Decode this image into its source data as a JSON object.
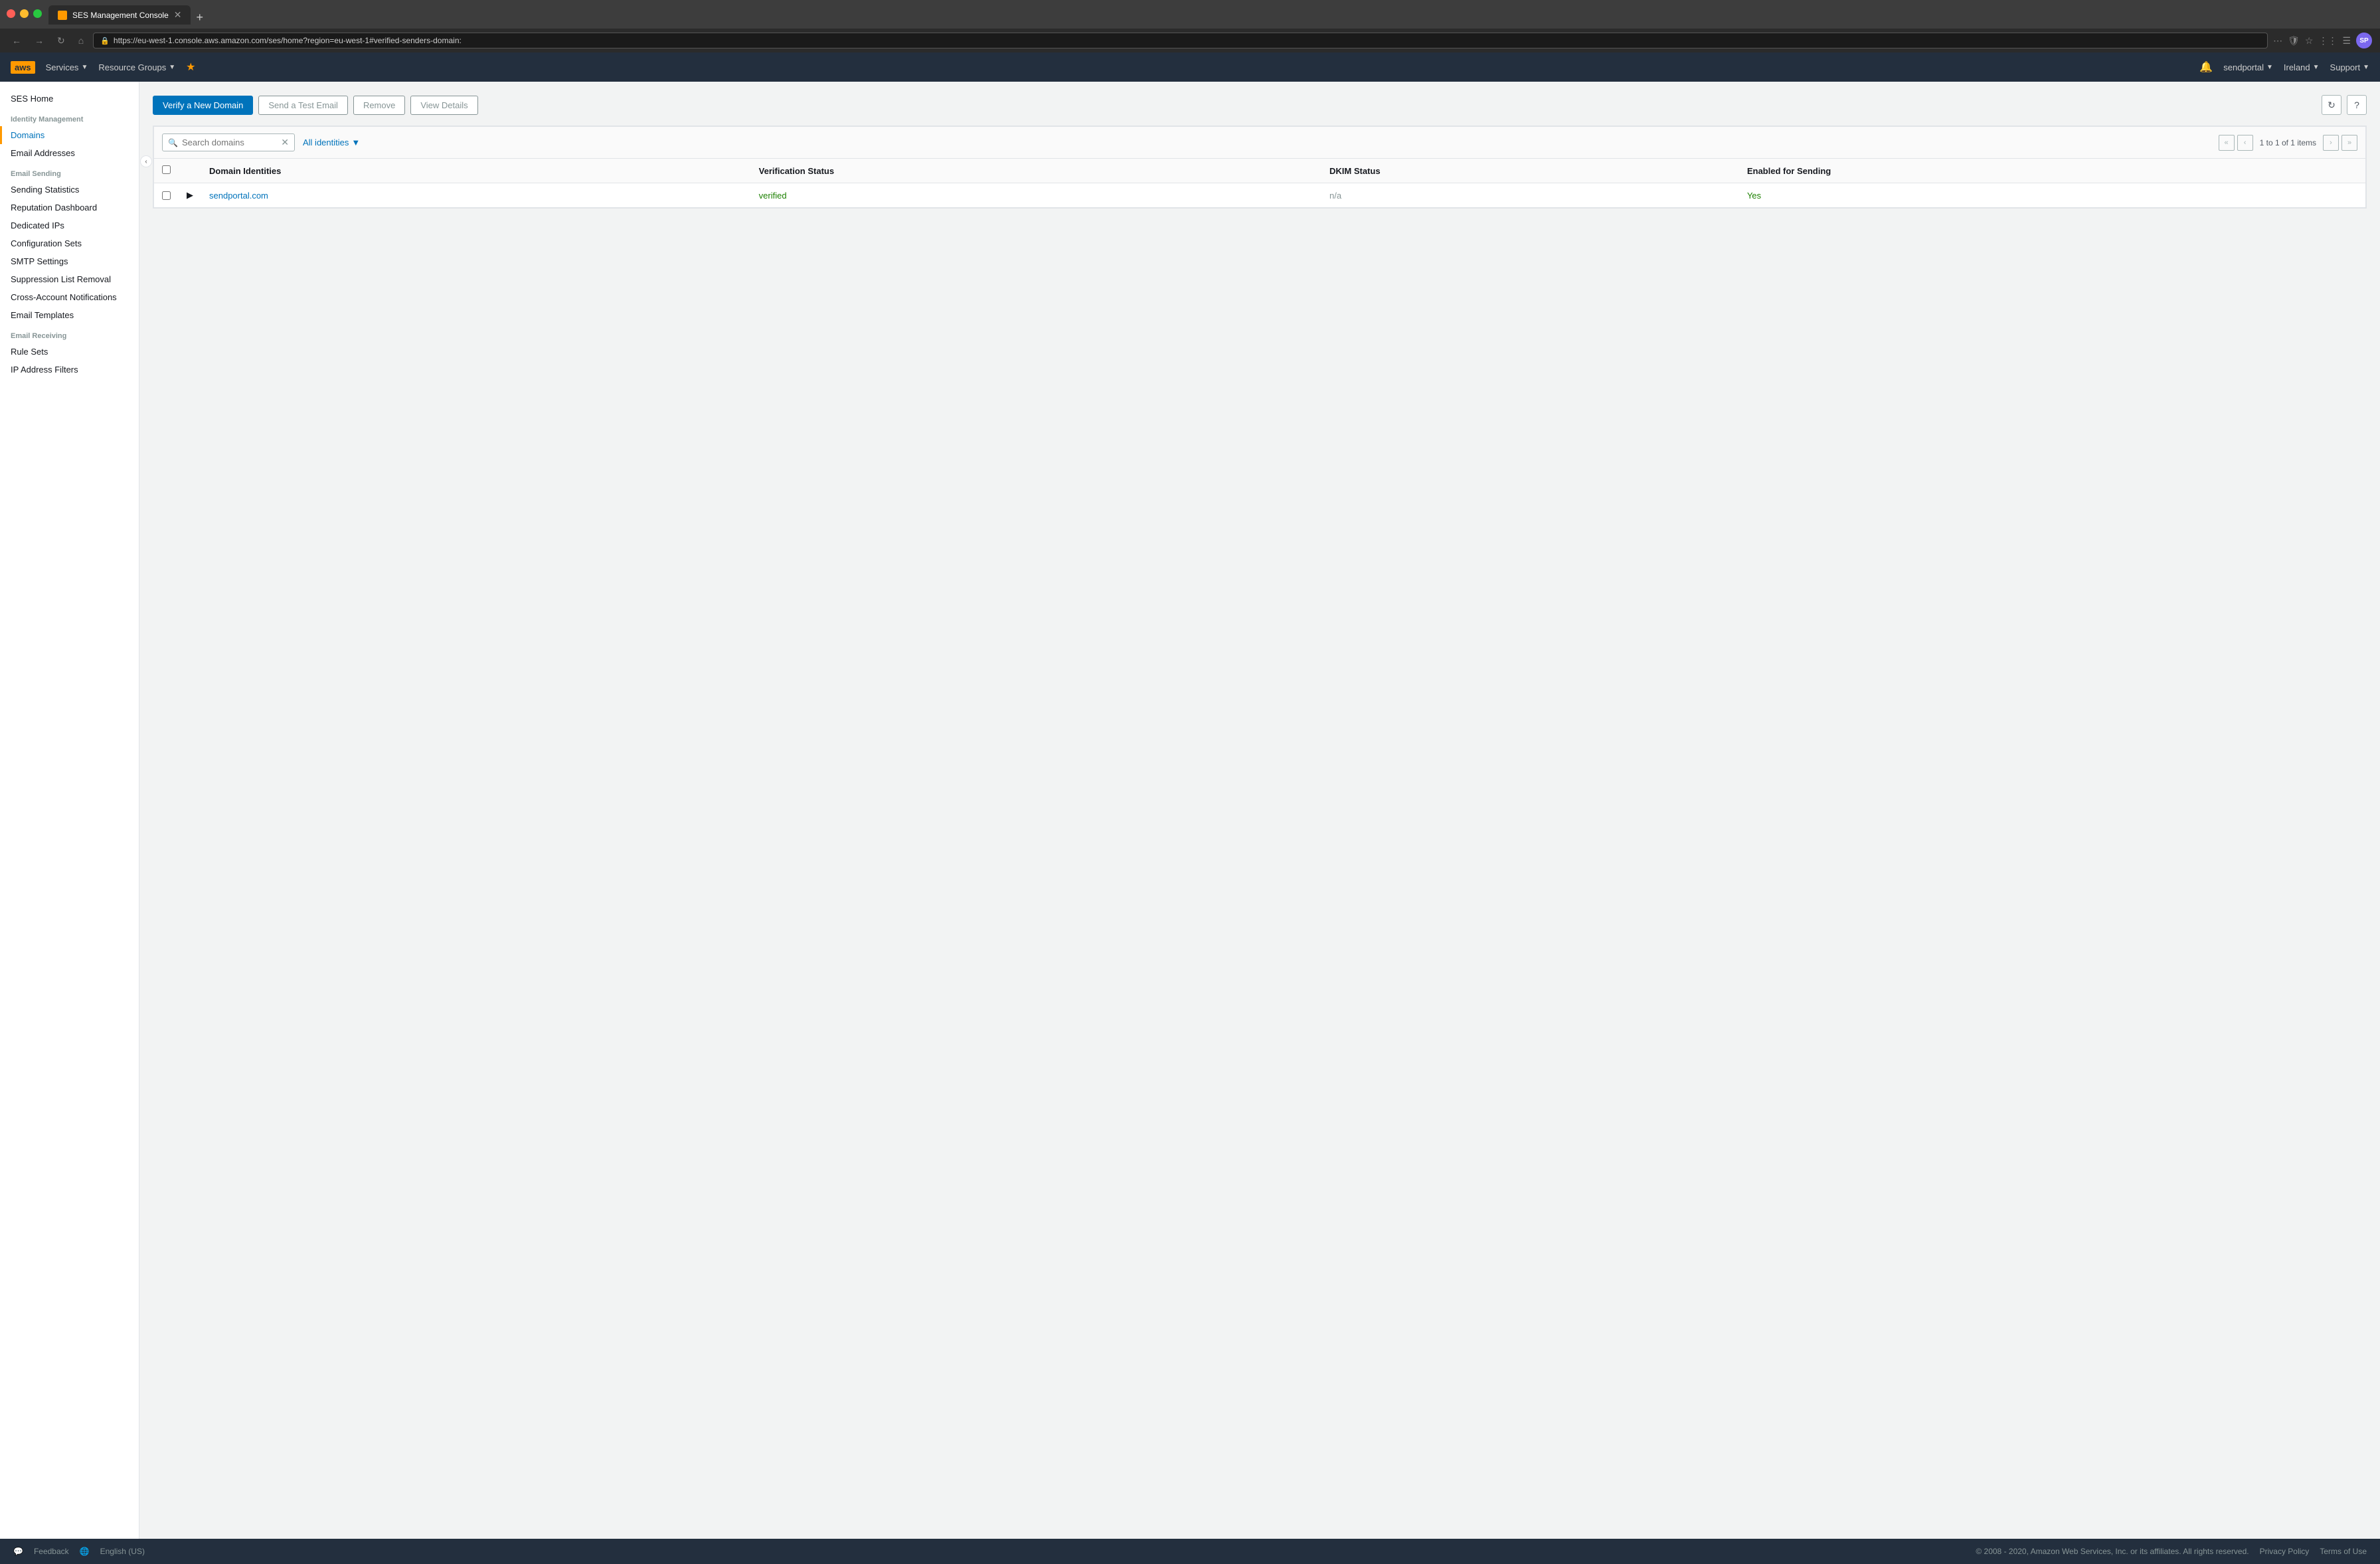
{
  "browser": {
    "tab_title": "SES Management Console",
    "url": "https://eu-west-1.console.aws.amazon.com/ses/home?region=eu-west-1#verified-senders-domain:",
    "profile_initials": "SP"
  },
  "aws_nav": {
    "logo": "aws",
    "services_label": "Services",
    "resource_groups_label": "Resource Groups",
    "region": "Ireland",
    "account": "sendportal",
    "support": "Support"
  },
  "sidebar": {
    "home": "SES Home",
    "identity_management": "Identity Management",
    "domains": "Domains",
    "email_addresses": "Email Addresses",
    "email_sending": "Email Sending",
    "sending_statistics": "Sending Statistics",
    "reputation_dashboard": "Reputation Dashboard",
    "dedicated_ips": "Dedicated IPs",
    "configuration_sets": "Configuration Sets",
    "smtp_settings": "SMTP Settings",
    "suppression_list_removal": "Suppression List Removal",
    "cross_account_notifications": "Cross-Account Notifications",
    "email_templates": "Email Templates",
    "email_receiving": "Email Receiving",
    "rule_sets": "Rule Sets",
    "ip_address_filters": "IP Address Filters"
  },
  "toolbar": {
    "verify_new_domain": "Verify a New Domain",
    "send_test_email": "Send a Test Email",
    "remove": "Remove",
    "view_details": "View Details"
  },
  "search": {
    "placeholder": "Search domains",
    "filter_label": "All identities"
  },
  "pagination": {
    "text": "1 to 1 of 1 items"
  },
  "table": {
    "col_domain": "Domain Identities",
    "col_verification": "Verification Status",
    "col_dkim": "DKIM Status",
    "col_sending": "Enabled for Sending",
    "rows": [
      {
        "domain": "sendportal.com",
        "verification": "verified",
        "dkim": "n/a",
        "sending": "Yes"
      }
    ]
  },
  "footer": {
    "feedback": "Feedback",
    "language": "English (US)",
    "copyright": "© 2008 - 2020, Amazon Web Services, Inc. or its affiliates. All rights reserved.",
    "privacy_policy": "Privacy Policy",
    "terms_of_use": "Terms of Use"
  }
}
